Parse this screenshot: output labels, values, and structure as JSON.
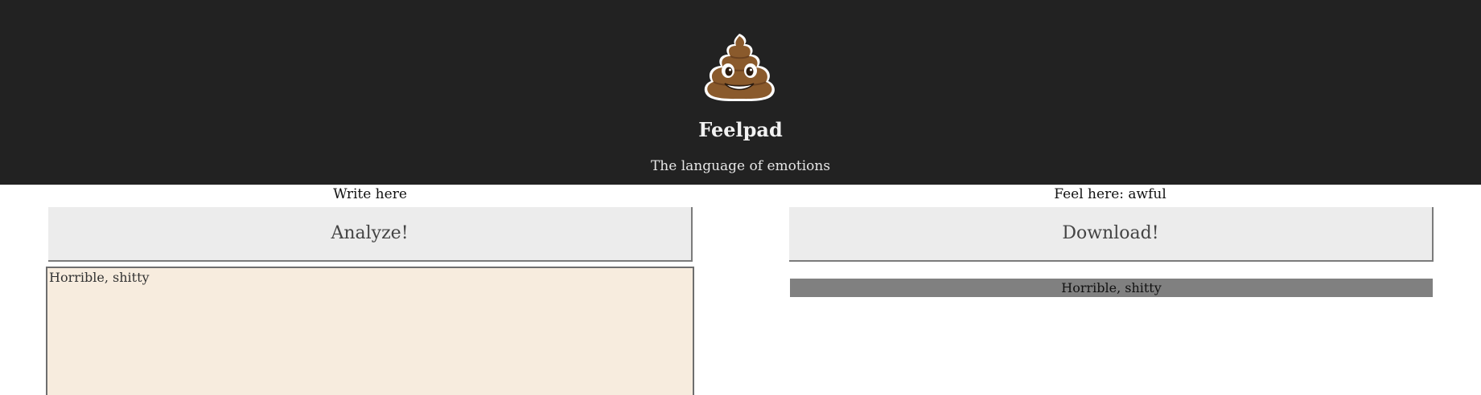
{
  "header": {
    "logo_icon": "pile-of-poo-emoji-icon",
    "title": "Feelpad",
    "subtitle": "The language of emotions",
    "background": "#222222"
  },
  "write_panel": {
    "label": "Write here",
    "analyze_label": "Analyze!",
    "text_value": "Horrible, shitty",
    "textarea_bg": "#f7ecde"
  },
  "feel_panel": {
    "label": "Feel here: awful",
    "download_label": "Download!",
    "output_text": "Horrible, shitty",
    "output_bg": "#808080"
  }
}
